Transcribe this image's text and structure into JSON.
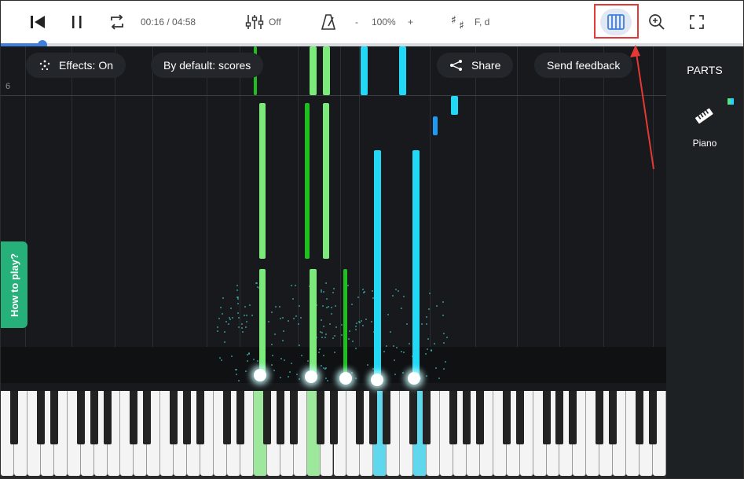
{
  "toolbar": {
    "time": "00:16 / 04:58",
    "mixer_state": "Off",
    "tempo_minus": "-",
    "tempo_value": "100%",
    "tempo_plus": "+",
    "key_signature": "F, d",
    "progress_fraction": 0.056
  },
  "canvas": {
    "measure_number": "6",
    "effects_label": "Effects: On",
    "default_label": "By default: scores",
    "share_label": "Share",
    "feedback_label": "Send feedback",
    "how_to_play": "How to play?"
  },
  "sidebar": {
    "title": "PARTS",
    "part_name": "Piano"
  },
  "colors": {
    "accent": "#3f7fd9",
    "note_green_light": "#7bea7b",
    "note_green_dark": "#1fbf1f",
    "note_cyan": "#21d9f5",
    "note_blue": "#1e9bf0",
    "how_to_play_bg": "#26b07a",
    "annotation_red": "#e53935"
  },
  "icons": {
    "skip_back": "skip-back-icon",
    "pause": "pause-icon",
    "loop": "loop-icon",
    "mixer": "mixer-sliders-icon",
    "metronome": "metronome-icon",
    "key": "sharp-key-icon",
    "piano_view": "piano-keys-icon",
    "zoom": "zoom-in-icon",
    "fullscreen": "fullscreen-icon",
    "effects": "sparkle-icon",
    "share": "share-icon",
    "piano_part": "piano-part-icon"
  }
}
